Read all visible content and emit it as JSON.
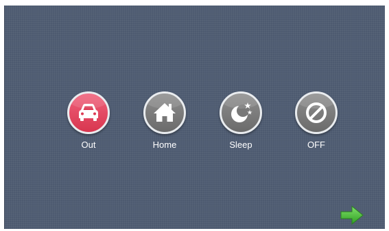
{
  "modes": [
    {
      "label": "Out",
      "icon": "car-icon",
      "active": true,
      "color": "#e8475f"
    },
    {
      "label": "Home",
      "icon": "house-icon",
      "active": false,
      "color": "#7d7d7d"
    },
    {
      "label": "Sleep",
      "icon": "moon-stars-icon",
      "active": false,
      "color": "#7d7d7d"
    },
    {
      "label": "OFF",
      "icon": "prohibited-icon",
      "active": false,
      "color": "#7d7d7d"
    }
  ],
  "navigation": {
    "next_icon": "arrow-right-icon",
    "next_color": "#3db82e"
  },
  "colors": {
    "background": "#4d5a70",
    "ring": "#e9ecef",
    "label": "#ffffff"
  }
}
